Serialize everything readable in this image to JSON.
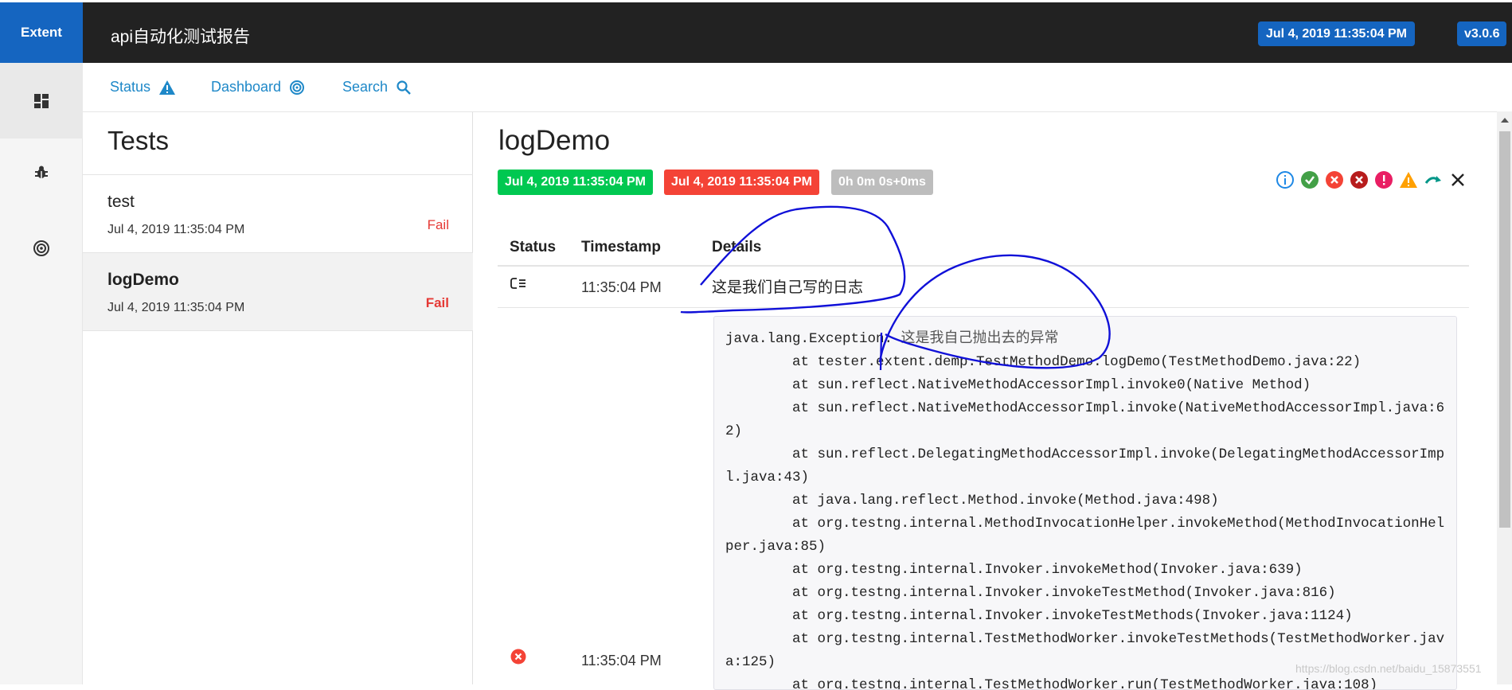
{
  "app": {
    "brand": "Extent",
    "report_title": "api自动化测试报告",
    "date_badge": "Jul 4, 2019 11:35:04 PM",
    "version": "v3.0.6"
  },
  "subnav": {
    "status_label": "Status",
    "dashboard_label": "Dashboard",
    "search_label": "Search"
  },
  "sidebar": {
    "items": [
      {
        "icon": "dashboard-grid-icon"
      },
      {
        "icon": "bug-icon"
      },
      {
        "icon": "dashboard-gauge-icon"
      }
    ]
  },
  "tests": {
    "heading": "Tests",
    "items": [
      {
        "name": "test",
        "time": "Jul 4, 2019 11:35:04 PM",
        "status": "Fail"
      },
      {
        "name": "logDemo",
        "time": "Jul 4, 2019 11:35:04 PM",
        "status": "Fail"
      }
    ]
  },
  "detail": {
    "title": "logDemo",
    "start_time": "Jul 4, 2019 11:35:04 PM",
    "end_time": "Jul 4, 2019 11:35:04 PM",
    "duration": "0h 0m 0s+0ms",
    "filter_icons": [
      "info-icon",
      "pass-icon",
      "fail-icon",
      "fatal-icon",
      "error-icon",
      "warning-icon",
      "skip-icon",
      "close-icon"
    ],
    "columns": {
      "status": "Status",
      "timestamp": "Timestamp",
      "details": "Details"
    },
    "rows": [
      {
        "status_icon": "log-icon",
        "timestamp": "11:35:04 PM",
        "details": "这是我们自己写的日志"
      },
      {
        "status_icon": "fail-icon",
        "timestamp": "11:35:04 PM"
      }
    ],
    "exception_head": "java.lang.Exception: ",
    "exception_msg": "这是我自己抛出去的异常",
    "stack_body": "\n        at tester.extent.demp.TestMethodDemo.logDemo(TestMethodDemo.java:22)\n        at sun.reflect.NativeMethodAccessorImpl.invoke0(Native Method)\n        at sun.reflect.NativeMethodAccessorImpl.invoke(NativeMethodAccessorImpl.java:62)\n        at sun.reflect.DelegatingMethodAccessorImpl.invoke(DelegatingMethodAccessorImpl.java:43)\n        at java.lang.reflect.Method.invoke(Method.java:498)\n        at org.testng.internal.MethodInvocationHelper.invokeMethod(MethodInvocationHelper.java:85)\n        at org.testng.internal.Invoker.invokeMethod(Invoker.java:639)\n        at org.testng.internal.Invoker.invokeTestMethod(Invoker.java:816)\n        at org.testng.internal.Invoker.invokeTestMethods(Invoker.java:1124)\n        at org.testng.internal.TestMethodWorker.invokeTestMethods(TestMethodWorker.java:125)\n        at org.testng.internal.TestMethodWorker.run(TestMethodWorker.java:108)"
  },
  "watermark": "https://blog.csdn.net/baidu_15873551",
  "colors": {
    "brand_blue": "#1565c0",
    "pass_green": "#00c851",
    "fail_red": "#e53935",
    "duration_gray": "#bdbdbd",
    "link_blue": "#1e88c8"
  }
}
